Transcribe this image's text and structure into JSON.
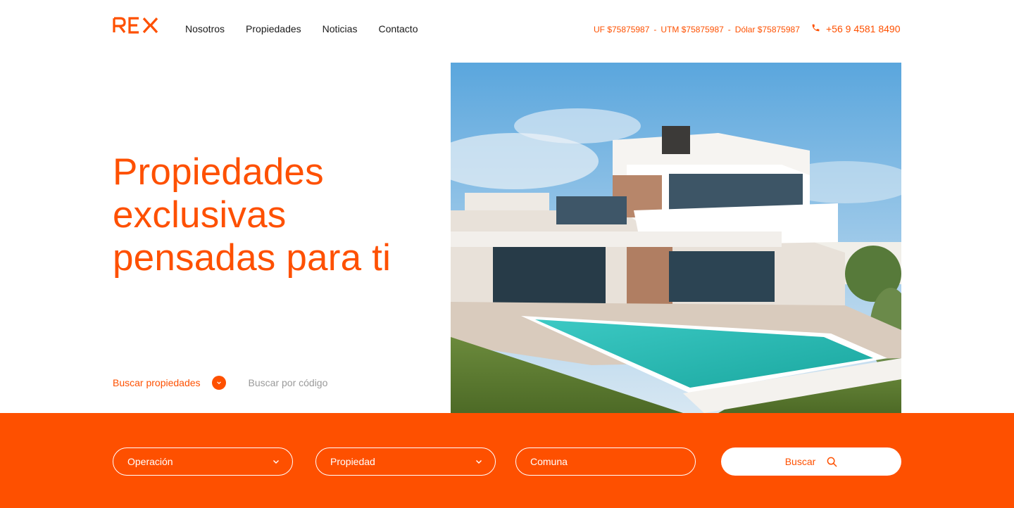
{
  "brand": {
    "logo_text": "REX",
    "accent": "#fe5000"
  },
  "nav": {
    "items": [
      "Nosotros",
      "Propiedades",
      "Noticias",
      "Contacto"
    ]
  },
  "rates": {
    "uf": "UF $75875987",
    "sep1": "-",
    "utm": "UTM $75875987",
    "sep2": "-",
    "dolar": "Dólar $75875987"
  },
  "contact": {
    "phone_icon": "phone-icon",
    "phone": "+56 9 4581 8490"
  },
  "hero": {
    "title_lines": [
      "Propiedades",
      "exclusivas",
      "pensadas para ti"
    ],
    "image_icon": "modern-house-with-pool-photo"
  },
  "search_tabs": {
    "active": "Buscar propiedades",
    "inactive": "Buscar por código"
  },
  "search": {
    "operacion": "Operación",
    "propiedad": "Propiedad",
    "comuna": "Comuna",
    "button": "Buscar"
  }
}
